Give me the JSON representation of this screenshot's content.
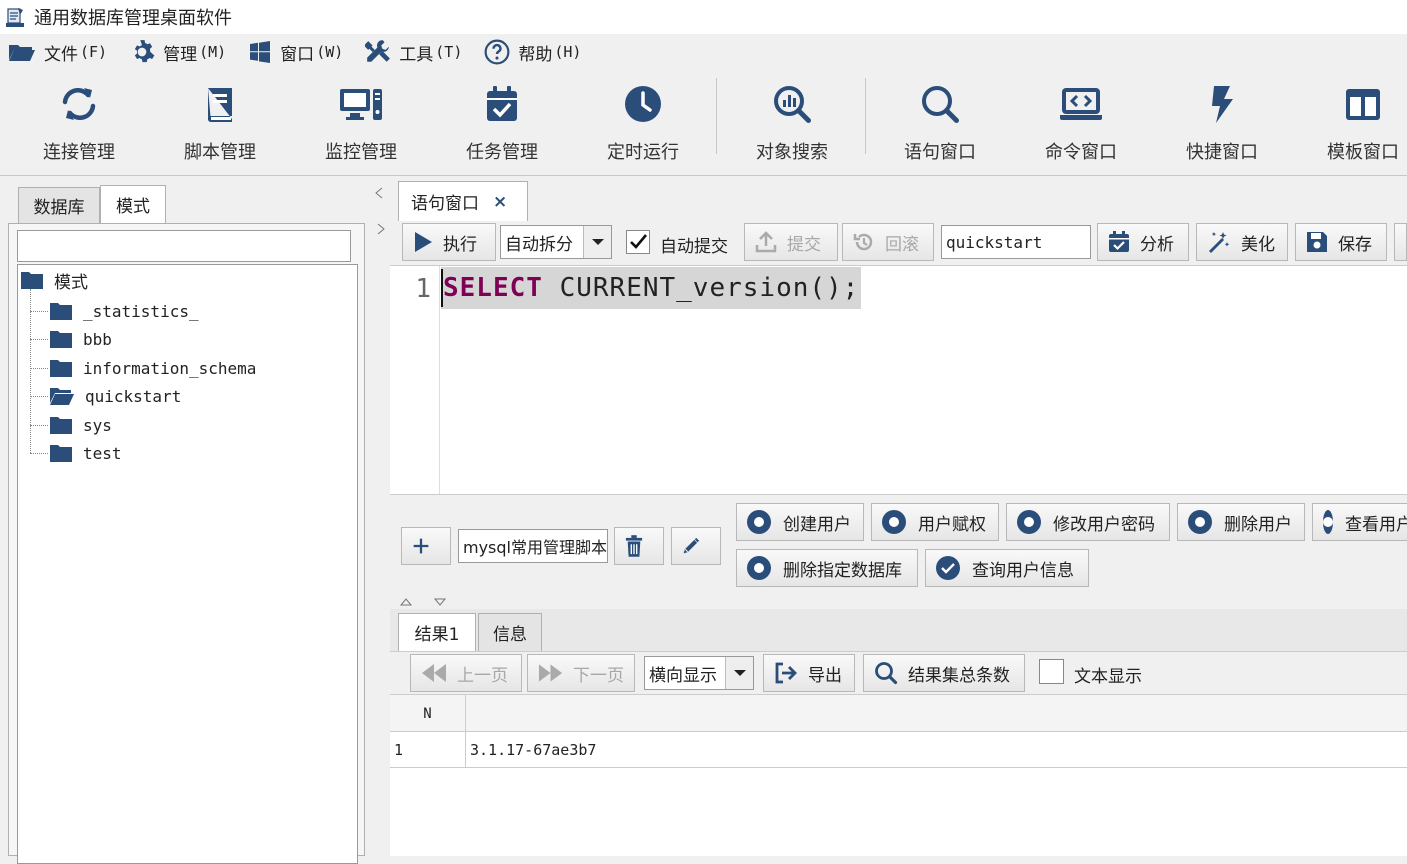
{
  "window": {
    "title": "通用数据库管理桌面软件"
  },
  "menu": [
    {
      "label": "文件",
      "key": "(F)",
      "icon": "folder-open-icon"
    },
    {
      "label": "管理",
      "key": "(M)",
      "icon": "gear-icon"
    },
    {
      "label": "窗口",
      "key": "(W)",
      "icon": "windows-icon"
    },
    {
      "label": "工具",
      "key": "(T)",
      "icon": "tools-icon"
    },
    {
      "label": "帮助",
      "key": "(H)",
      "icon": "help-icon"
    }
  ],
  "toolbar": {
    "items": [
      {
        "label": "连接管理",
        "icon": "sync-icon"
      },
      {
        "label": "脚本管理",
        "icon": "book-icon"
      },
      {
        "label": "监控管理",
        "icon": "monitor-icon"
      },
      {
        "label": "任务管理",
        "icon": "calendar-check-icon"
      },
      {
        "label": "定时运行",
        "icon": "clock-icon"
      },
      {
        "label": "对象搜索",
        "icon": "search-chart-icon"
      },
      {
        "label": "语句窗口",
        "icon": "search-icon"
      },
      {
        "label": "命令窗口",
        "icon": "laptop-code-icon"
      },
      {
        "label": "快捷窗口",
        "icon": "bolt-icon"
      },
      {
        "label": "模板窗口",
        "icon": "columns-icon"
      }
    ]
  },
  "left": {
    "tabs": [
      "数据库",
      "模式"
    ],
    "active_tab": "模式",
    "filter_value": "",
    "tree_root": "模式",
    "schemas": [
      "_statistics_",
      "bbb",
      "information_schema",
      "quickstart",
      "sys",
      "test"
    ],
    "open_schema": "quickstart"
  },
  "editor_tab": {
    "label": "语句窗口",
    "close": "×"
  },
  "editor_toolbar": {
    "run": "执行",
    "split_mode": "自动拆分",
    "autocommit_label": "自动提交",
    "autocommit_checked": true,
    "commit": "提交",
    "rollback": "回滚",
    "schema_value": "quickstart",
    "analyze": "分析",
    "beautify": "美化",
    "save": "保存"
  },
  "editor": {
    "line_number": "1",
    "keyword": "SELECT",
    "rest": " CURRENT_version();"
  },
  "quick": {
    "template_value": "mysql常用管理脚本",
    "buttons_row1": [
      "创建用户",
      "用户赋权",
      "修改用户密码",
      "删除用户",
      "查看用户"
    ],
    "buttons_row2": [
      "删除指定数据库",
      "查询用户信息"
    ]
  },
  "results": {
    "tabs": [
      "结果1",
      "信息"
    ],
    "active_tab": "结果1",
    "prev": "上一页",
    "next": "下一页",
    "display_mode": "横向显示",
    "export": "导出",
    "count": "结果集总条数",
    "text_display": "文本显示",
    "columns": [
      "N",
      ""
    ],
    "rows": [
      [
        "1",
        "3.1.17-67ae3b7"
      ]
    ]
  },
  "colors": {
    "accent": "#2a4e79",
    "keyword": "#7f0055",
    "selection": "#d6d6d6"
  }
}
